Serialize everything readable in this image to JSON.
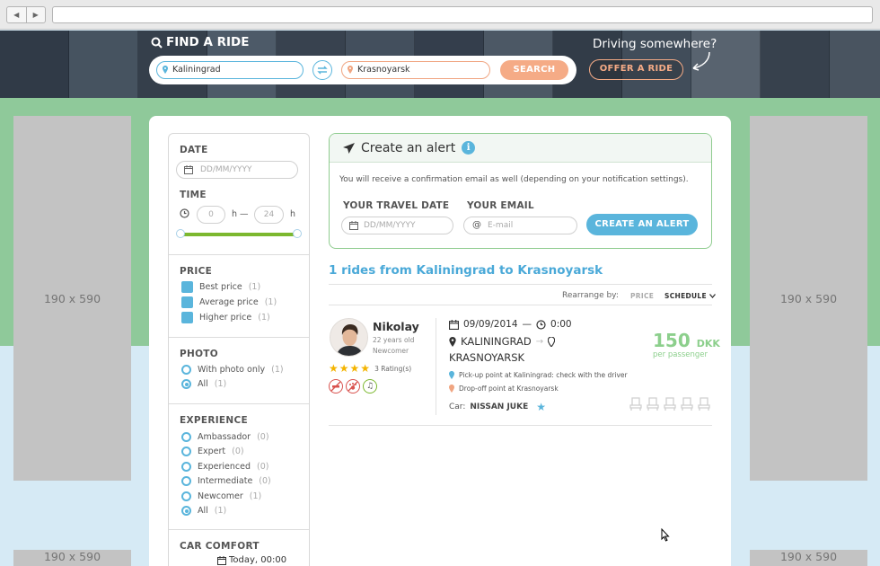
{
  "hero": {
    "title": "FIND A RIDE",
    "from_value": "Kaliningrad",
    "to_value": "Krasnoyarsk",
    "search_label": "SEARCH",
    "driving_text": "Driving somewhere?",
    "offer_label": "OFFER A RIDE"
  },
  "ads": {
    "left": "190 x 590",
    "right": "190 x 590",
    "left_bottom": "190 x 590",
    "right_bottom": "190 x 590"
  },
  "filters": {
    "date": {
      "title": "DATE",
      "placeholder": "DD/MM/YYYY"
    },
    "time": {
      "title": "TIME",
      "from_placeholder": "0",
      "to_placeholder": "24",
      "unit": "h",
      "sep": "h —",
      "range": [
        0,
        24
      ]
    },
    "price": {
      "title": "PRICE",
      "options": [
        {
          "label": "Best price",
          "count": "(1)"
        },
        {
          "label": "Average price",
          "count": "(1)"
        },
        {
          "label": "Higher price",
          "count": "(1)"
        }
      ]
    },
    "photo": {
      "title": "PHOTO",
      "options": [
        {
          "label": "With photo only",
          "count": "(1)"
        },
        {
          "label": "All",
          "count": "(1)"
        }
      ]
    },
    "experience": {
      "title": "EXPERIENCE",
      "options": [
        {
          "label": "Ambassador",
          "count": "(0)"
        },
        {
          "label": "Expert",
          "count": "(0)"
        },
        {
          "label": "Experienced",
          "count": "(0)"
        },
        {
          "label": "Intermediate",
          "count": "(0)"
        },
        {
          "label": "Newcomer",
          "count": "(1)"
        },
        {
          "label": "All",
          "count": "(1)"
        }
      ]
    },
    "car_comfort": {
      "title": "CAR COMFORT"
    }
  },
  "alert": {
    "title": "Create an alert",
    "info": "i",
    "message": "You will receive a confirmation email as well (depending on your notification settings).",
    "date_label": "YOUR TRAVEL DATE",
    "date_placeholder": "DD/MM/YYYY",
    "email_label": "YOUR EMAIL",
    "email_placeholder": "E-mail",
    "button": "CREATE AN ALERT"
  },
  "results": {
    "title": "1 rides from Kaliningrad to Krasnoyarsk",
    "rearrange": "Rearrange by:",
    "sort_price": "PRICE",
    "sort_schedule": "SCHEDULE"
  },
  "ride": {
    "driver_name": "Nikolay",
    "age": "22 years old",
    "level": "Newcomer",
    "rating_stars": 4,
    "ratings": "3 Rating(s)",
    "date": "09/09/2014",
    "dash": "—",
    "time": "0:00",
    "from_city": "KALININGRAD",
    "to_city": "KRASNOYARSK",
    "pickup": "Pick-up point at Kaliningrad: check with the driver",
    "dropoff": "Drop-off point at Krasnoyarsk",
    "car_label": "Car:",
    "car_name": "NISSAN JUKE",
    "price": "150",
    "currency": "DKK",
    "per_passenger": "per passenger",
    "seats": 5
  },
  "footer_peek": {
    "today": "Today, 00:00"
  },
  "colors": {
    "blue": "#5ab5dc",
    "orange": "#f5ab86",
    "green": "#8fc99a",
    "price_green": "#8ccf8c"
  }
}
